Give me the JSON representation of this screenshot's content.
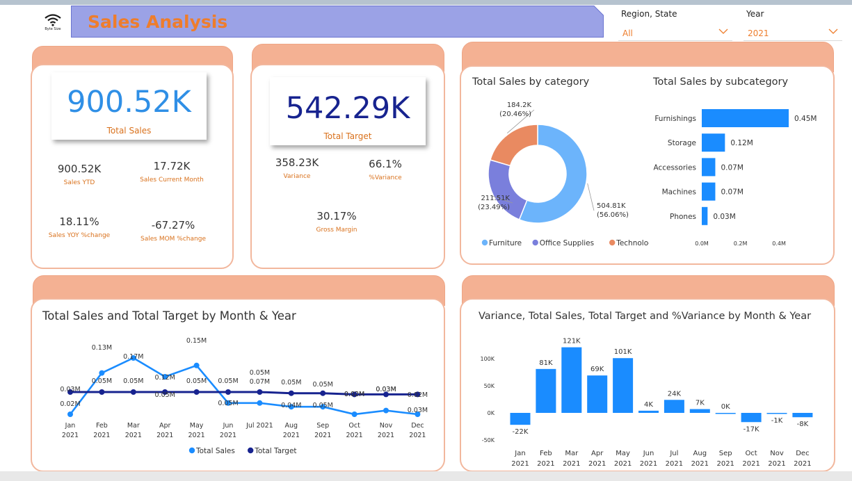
{
  "header": {
    "title": "Sales Analysis",
    "logo_text": "Byte Size",
    "filters": [
      {
        "label": "Region, State",
        "value": "All"
      },
      {
        "label": "Year",
        "value": "2021"
      }
    ]
  },
  "kpi1": {
    "value": "900.52K",
    "label": "Total Sales",
    "metrics": [
      {
        "value": "900.52K",
        "label": "Sales YTD"
      },
      {
        "value": "17.72K",
        "label": "Sales Current Month"
      },
      {
        "value": "18.11%",
        "label": "Sales YOY %change"
      },
      {
        "value": "-67.27%",
        "label": "Sales MOM %change"
      }
    ]
  },
  "kpi2": {
    "value": "542.29K",
    "label": "Total Target",
    "metrics": [
      {
        "value": "358.23K",
        "label": "Variance"
      },
      {
        "value": "66.1%",
        "label": "%Variance"
      },
      {
        "value": "30.17%",
        "label": "Gross Margin"
      }
    ]
  },
  "colors": {
    "accent": "#ee7d2c",
    "kpi1_value": "#2f8fe6",
    "kpi2_value": "#17238f",
    "card_head": "#f4b193",
    "card_border": "#f2b79d",
    "bar": "#1a8cff",
    "series_sales": "#1a8cff",
    "series_target": "#17238f",
    "furniture": "#6cb4fb",
    "office_supplies": "#7a7fdc",
    "technology": "#e98a61"
  },
  "chart_data": [
    {
      "type": "pie",
      "title": "Total Sales by category",
      "donut": true,
      "slices": [
        {
          "name": "Furniture",
          "value": 504.81,
          "label": "504.81K",
          "pct_label": "(56.06%)",
          "color": "#6cb4fb"
        },
        {
          "name": "Office Supplies",
          "value": 211.51,
          "label": "211.51K",
          "pct_label": "(23.49%)",
          "color": "#7a7fdc"
        },
        {
          "name": "Technology",
          "value": 184.2,
          "label": "184.2K",
          "pct_label": "(20.46%)",
          "color": "#e98a61"
        }
      ],
      "legend_position": "bottom"
    },
    {
      "type": "bar",
      "orientation": "horizontal",
      "title": "Total Sales by subcategory",
      "categories": [
        "Furnishings",
        "Storage",
        "Accessories",
        "Machines",
        "Phones"
      ],
      "values": [
        0.45,
        0.12,
        0.07,
        0.07,
        0.03
      ],
      "data_labels": [
        "0.45M",
        "0.12M",
        "0.07M",
        "0.07M",
        "0.03M"
      ],
      "xticks": [
        "0.0M",
        "0.2M",
        "0.4M"
      ],
      "xlim": [
        0,
        0.45
      ]
    },
    {
      "type": "line",
      "title": "Total Sales and Total Target by Month & Year",
      "categories": [
        "Jan 2021",
        "Feb 2021",
        "Mar 2021",
        "Apr 2021",
        "May 2021",
        "Jun 2021",
        "Jul 2021",
        "Aug 2021",
        "Sep 2021",
        "Oct 2021",
        "Nov 2021",
        "Dec 2021"
      ],
      "tick_month": [
        "Jan",
        "Feb",
        "Mar",
        "Apr",
        "May",
        "Jun",
        "Jul 2021",
        "Aug",
        "Sep",
        "Oct",
        "Nov",
        "Dec"
      ],
      "tick_year": [
        "2021",
        "2021",
        "2021",
        "2021",
        "2021",
        "2021",
        "",
        "2021",
        "2021",
        "2021",
        "2021",
        "2021"
      ],
      "series": [
        {
          "name": "Total Sales",
          "values": [
            0.02,
            0.13,
            0.17,
            0.12,
            0.15,
            0.05,
            0.05,
            0.04,
            0.04,
            0.02,
            0.03,
            0.02
          ],
          "labels": [
            "0.02M",
            "0.13M",
            "0.17M",
            "0.12M",
            "0.15M",
            "0.05M",
            "0.05M",
            "0.04M",
            "0.05M",
            "0.02M",
            "0.03M",
            "0.03M"
          ]
        },
        {
          "name": "Total Target",
          "values": [
            0.05,
            0.05,
            0.05,
            0.05,
            0.05,
            0.05,
            0.05,
            0.04,
            0.04,
            0.03,
            0.03,
            0.03
          ],
          "labels": [
            "0.03M",
            "0.05M",
            "0.05M",
            "0.05M",
            "0.05M",
            "0.05M",
            "0.07M",
            "0.05M",
            "0.05M",
            "0.02M",
            "0.03M",
            "0.02M"
          ]
        }
      ],
      "legend_position": "bottom"
    },
    {
      "type": "bar",
      "title": "Variance, Total Sales, Total Target and %Variance by Month & Year",
      "categories": [
        "Jan 2021",
        "Feb 2021",
        "Mar 2021",
        "Apr 2021",
        "May 2021",
        "Jun 2021",
        "Jul 2021",
        "Aug 2021",
        "Sep 2021",
        "Oct 2021",
        "Nov 2021",
        "Dec 2021"
      ],
      "tick_month": [
        "Jan",
        "Feb",
        "Mar",
        "Apr",
        "May",
        "Jun",
        "Jul",
        "Aug",
        "Sep",
        "Oct",
        "Nov",
        "Dec"
      ],
      "tick_year": [
        "2021",
        "2021",
        "2021",
        "2021",
        "2021",
        "2021",
        "2021",
        "2021",
        "2021",
        "2021",
        "2021",
        "2021"
      ],
      "values": [
        -22,
        81,
        121,
        69,
        101,
        4,
        24,
        7,
        0,
        -17,
        -1,
        -8
      ],
      "data_labels": [
        "-22K",
        "81K",
        "121K",
        "69K",
        "101K",
        "4K",
        "24K",
        "7K",
        "0K",
        "-17K",
        "-1K",
        "-8K"
      ],
      "yticks": [
        "100K",
        "50K",
        "0K",
        "-50K"
      ],
      "ylim": [
        -50,
        121
      ]
    }
  ]
}
